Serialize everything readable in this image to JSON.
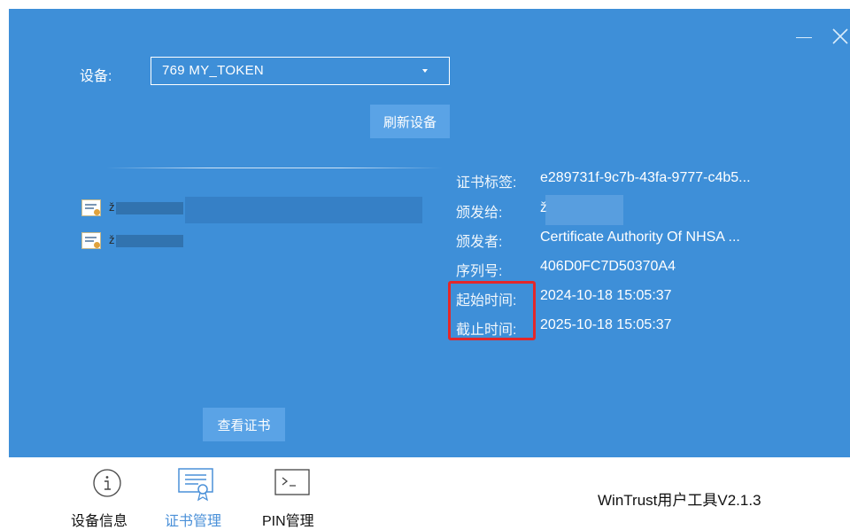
{
  "window": {
    "minimize_icon": "minimize-icon",
    "close_icon": "close-icon"
  },
  "device": {
    "label": "设备:",
    "selected": "769  MY_TOKEN",
    "refresh_label": "刷新设备"
  },
  "certificates": {
    "items": [
      {
        "name": "ž",
        "selected": true
      },
      {
        "name": "ž",
        "selected": false
      }
    ]
  },
  "details": {
    "label_tag": "证书标签:",
    "value_tag": "e289731f-9c7b-43fa-9777-c4b5...",
    "label_issued_to": "颁发给:",
    "value_issued_to": "ž",
    "label_issuer": "颁发者:",
    "value_issuer": "Certificate Authority Of NHSA ...",
    "label_serial": "序列号:",
    "value_serial": "406D0FC7D50370A4",
    "label_start": "起始时间:",
    "value_start": "2024-10-18 15:05:37",
    "label_end": "截止时间:",
    "value_end": "2025-10-18 15:05:37"
  },
  "view_button": "查看证书",
  "tabs": [
    {
      "label": "设备信息",
      "icon": "info-icon",
      "active": false
    },
    {
      "label": "证书管理",
      "icon": "certificate-icon",
      "active": true
    },
    {
      "label": "PIN管理",
      "icon": "terminal-icon",
      "active": false
    }
  ],
  "footer": {
    "app_title": "WinTrust用户工具V2.1.3"
  },
  "colors": {
    "panel": "#3e8fd8",
    "button": "#5aa3e6",
    "highlight": "#e3272a",
    "active_tab": "#4a90d8"
  }
}
